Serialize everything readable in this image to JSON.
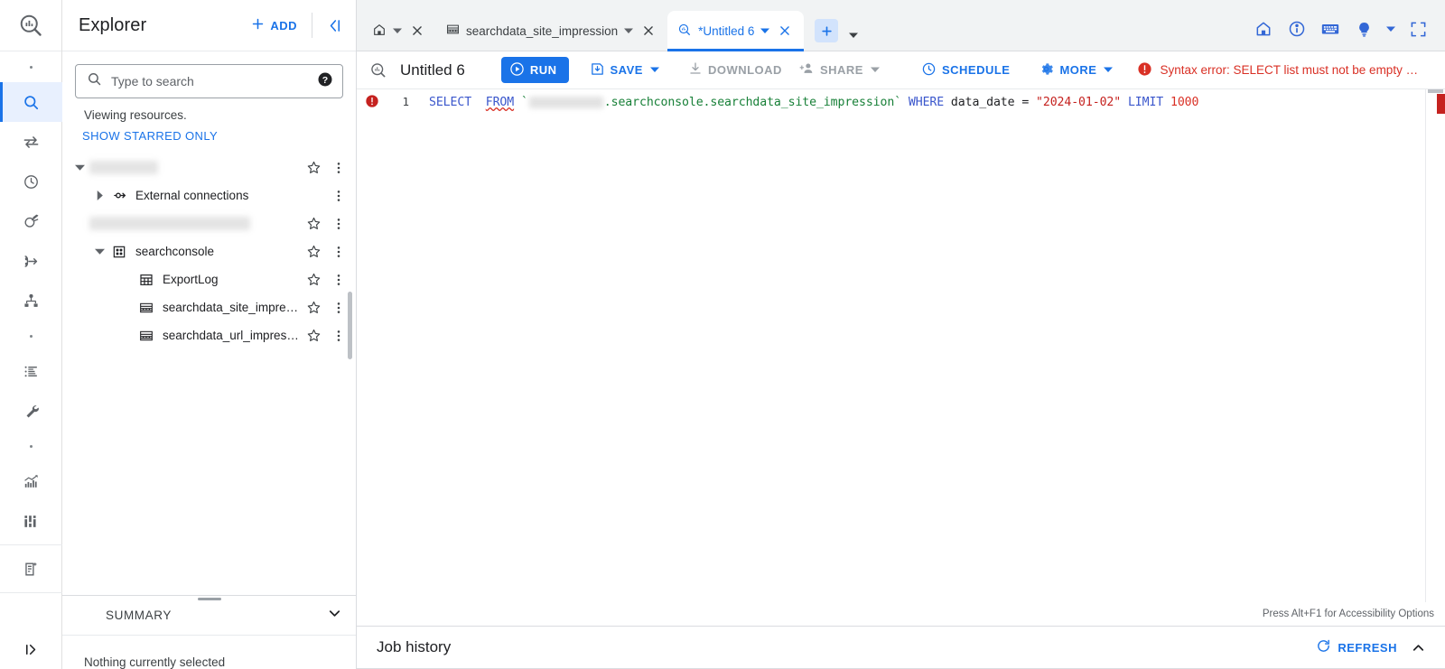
{
  "rail": {
    "logo_icon": "bigquery-logo-icon",
    "items": [
      {
        "icon": "dot-separator-icon",
        "name": "rail-dot-1",
        "type": "dot"
      },
      {
        "icon": "search-icon",
        "name": "rail-item-search",
        "type": "icon",
        "active": true
      },
      {
        "icon": "transfers-icon",
        "name": "rail-item-data-transfers",
        "type": "icon"
      },
      {
        "icon": "scheduled-queries-icon",
        "name": "rail-item-scheduled-queries",
        "type": "icon"
      },
      {
        "icon": "analytics-hub-icon",
        "name": "rail-item-analytics-hub",
        "type": "icon"
      },
      {
        "icon": "dataflow-icon",
        "name": "rail-item-dataflow",
        "type": "icon"
      },
      {
        "icon": "data-lineage-icon",
        "name": "rail-item-data-lineage",
        "type": "icon"
      },
      {
        "icon": "dot-separator-icon",
        "name": "rail-dot-2",
        "type": "dot"
      },
      {
        "icon": "list-icon",
        "name": "rail-item-job-history",
        "type": "icon"
      },
      {
        "icon": "wrench-icon",
        "name": "rail-item-admin",
        "type": "icon"
      },
      {
        "icon": "dot-separator-icon",
        "name": "rail-dot-3",
        "type": "dot"
      },
      {
        "icon": "monitoring-chart-icon",
        "name": "rail-item-monitoring",
        "type": "icon"
      },
      {
        "icon": "bi-engine-icon",
        "name": "rail-item-bi-engine",
        "type": "icon"
      },
      {
        "icon": "notebook-icon",
        "name": "rail-item-notebooks",
        "type": "icon",
        "sep_before": true
      }
    ],
    "bottom": {
      "icon": "expand-panel-icon",
      "name": "rail-item-expand"
    }
  },
  "explorer": {
    "title": "Explorer",
    "add_label": "ADD",
    "collapse_icon": "collapse-panel-icon",
    "search": {
      "placeholder": "Type to search",
      "value": "",
      "help_icon": "help-filled-icon"
    },
    "viewing_text": "Viewing resources.",
    "starred_link": "SHOW STARRED ONLY",
    "tree": [
      {
        "label": "",
        "redacted": true,
        "redact_width": 76,
        "indent": 0,
        "twisty": "expanded",
        "icon": "",
        "star": true,
        "menu": true,
        "name": "tree-node-project-1"
      },
      {
        "label": "External connections",
        "redacted": false,
        "indent": 1,
        "twisty": "collapsed",
        "icon": "external-connection-icon",
        "star": false,
        "menu": true,
        "name": "tree-node-external-connections"
      },
      {
        "label": "",
        "redacted": true,
        "redact_width": 170,
        "indent": 0,
        "twisty": "none",
        "icon": "",
        "star": true,
        "menu": true,
        "name": "tree-node-project-2"
      },
      {
        "label": "searchconsole",
        "redacted": false,
        "indent": 1,
        "twisty": "expanded",
        "icon": "dataset-icon",
        "star": true,
        "menu": true,
        "name": "tree-node-dataset-searchconsole"
      },
      {
        "label": "ExportLog",
        "redacted": false,
        "indent": 2,
        "twisty": "none",
        "icon": "table-icon",
        "star": true,
        "menu": true,
        "name": "tree-node-table-exportlog"
      },
      {
        "label": "searchdata_site_impres…",
        "redacted": false,
        "indent": 2,
        "twisty": "none",
        "icon": "view-table-icon",
        "star": true,
        "menu": true,
        "name": "tree-node-table-searchdata-site-impression"
      },
      {
        "label": "searchdata_url_impress…",
        "redacted": false,
        "indent": 2,
        "twisty": "none",
        "icon": "view-table-icon",
        "star": true,
        "menu": true,
        "name": "tree-node-table-searchdata-url-impression"
      }
    ],
    "summary": {
      "label": "SUMMARY",
      "chevron_icon": "chevron-down-icon",
      "body": "Nothing currently selected"
    }
  },
  "tabbar": {
    "tabs": [
      {
        "label": "",
        "icon": "home-icon",
        "caret": true,
        "close": true,
        "active": false,
        "name": "tab-home"
      },
      {
        "label": "searchdata_site_impression",
        "icon": "view-table-icon",
        "caret": true,
        "close": true,
        "active": false,
        "name": "tab-searchdata-site-impression"
      },
      {
        "label": "*Untitled 6",
        "icon": "query-icon",
        "caret": true,
        "close": true,
        "active": true,
        "name": "tab-untitled-6"
      }
    ],
    "new_tab_icon": "add-tab-icon",
    "new_tab_caret_icon": "chevron-down-icon",
    "right_icons": [
      {
        "icon": "home-outline-icon",
        "name": "header-home-button"
      },
      {
        "icon": "info-circle-icon",
        "name": "header-info-button"
      },
      {
        "icon": "keyboard-icon",
        "name": "header-keyboard-shortcuts-button"
      },
      {
        "icon": "lightbulb-icon",
        "name": "header-help-button"
      },
      {
        "icon": "chevron-down-icon",
        "name": "header-help-caret"
      },
      {
        "icon": "fullscreen-icon",
        "name": "header-fullscreen-button"
      }
    ]
  },
  "query_toolbar": {
    "query_icon": "query-icon",
    "title": "Untitled 6",
    "run_label": "RUN",
    "run_icon": "play-icon",
    "run_color": "#1a73e8",
    "save_label": "SAVE",
    "save_icon": "save-icon",
    "download_label": "DOWNLOAD",
    "download_icon": "download-icon",
    "share_label": "SHARE",
    "share_icon": "share-person-icon",
    "schedule_label": "SCHEDULE",
    "schedule_icon": "clock-icon",
    "more_label": "MORE",
    "more_icon": "gear-icon",
    "error_text": "Syntax error: SELECT list must not be empty …",
    "error_icon": "error-filled-icon",
    "error_color": "#d93025"
  },
  "editor": {
    "error_gutter_icon": "error-filled-icon",
    "line_number": "1",
    "code_tokens": [
      {
        "text": "SELECT",
        "type": "kw"
      },
      {
        "text": " ",
        "type": "plain"
      },
      {
        "text": "FROM",
        "type": "kw-err"
      },
      {
        "text": " ",
        "type": "plain"
      },
      {
        "text": "`",
        "type": "tbl"
      },
      {
        "text": "[REDACTED]",
        "type": "redact"
      },
      {
        "text": ".searchconsole.searchdata_site_impression`",
        "type": "tbl"
      },
      {
        "text": " ",
        "type": "plain"
      },
      {
        "text": "WHERE",
        "type": "kw"
      },
      {
        "text": " data_date = ",
        "type": "plain"
      },
      {
        "text": "\"2024-01-02\"",
        "type": "str"
      },
      {
        "text": " ",
        "type": "plain"
      },
      {
        "text": "LIMIT",
        "type": "kw"
      },
      {
        "text": " ",
        "type": "plain"
      },
      {
        "text": "1000",
        "type": "num"
      }
    ],
    "accessibility_hint": "Press Alt+F1 for Accessibility Options"
  },
  "job_history": {
    "title": "Job history",
    "refresh_label": "REFRESH",
    "refresh_icon": "refresh-icon",
    "chevron_icon": "chevron-up-icon"
  }
}
